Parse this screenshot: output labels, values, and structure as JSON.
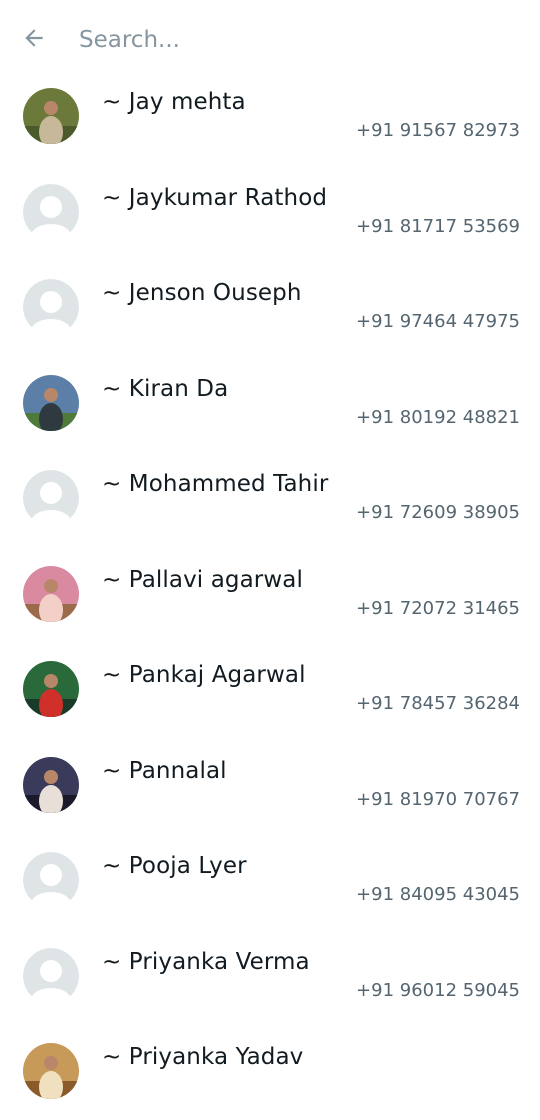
{
  "search": {
    "placeholder": "Search...",
    "value": ""
  },
  "icons": {
    "back": "arrow-left-icon"
  },
  "colors": {
    "name_text": "#111b21",
    "secondary_text": "#54656f",
    "placeholder": "#8696a0",
    "default_avatar_bg": "#dfe5e7",
    "default_avatar_fg": "#ffffff"
  },
  "contacts": [
    {
      "name": "~ Jay mehta",
      "phone": "+91 91567 82973",
      "avatar": "photo",
      "palette": [
        "#6b7a3a",
        "#c8b89a",
        "#4a5a2a"
      ]
    },
    {
      "name": "~ Jaykumar Rathod",
      "phone": "+91 81717 53569",
      "avatar": "default"
    },
    {
      "name": "~ Jenson Ouseph",
      "phone": "+91 97464 47975",
      "avatar": "default"
    },
    {
      "name": "~ Kiran Da",
      "phone": "+91 80192 48821",
      "avatar": "photo",
      "palette": [
        "#5b7fa6",
        "#2e3a3f",
        "#4f7a3a"
      ]
    },
    {
      "name": "~ Mohammed Tahir",
      "phone": "+91 72609 38905",
      "avatar": "default"
    },
    {
      "name": "~ Pallavi agarwal",
      "phone": "+91 72072 31465",
      "avatar": "photo",
      "palette": [
        "#d98aa0",
        "#f2d0c8",
        "#9a6a4a"
      ]
    },
    {
      "name": "~ Pankaj Agarwal",
      "phone": "+91 78457 36284",
      "avatar": "photo",
      "palette": [
        "#2a6a3a",
        "#d0302a",
        "#1a3a2a"
      ]
    },
    {
      "name": "~ Pannalal",
      "phone": "+91 81970 70767",
      "avatar": "photo",
      "palette": [
        "#3a3a5a",
        "#e8e0d8",
        "#1a1a2a"
      ]
    },
    {
      "name": "~ Pooja Lyer",
      "phone": "+91 84095 43045",
      "avatar": "default"
    },
    {
      "name": "~ Priyanka Verma",
      "phone": "+91 96012 59045",
      "avatar": "default"
    },
    {
      "name": "~ Priyanka Yadav",
      "phone": "",
      "avatar": "photo",
      "palette": [
        "#c89a5a",
        "#f0e0c0",
        "#8a5a2a"
      ]
    }
  ]
}
